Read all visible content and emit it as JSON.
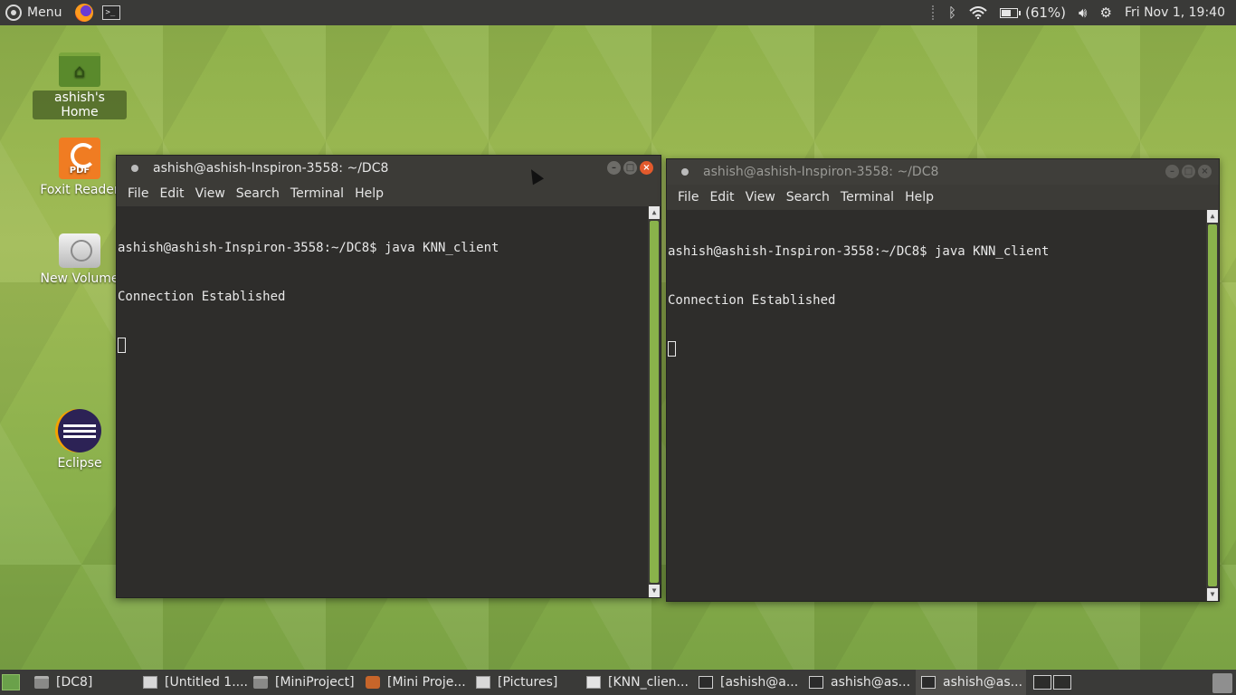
{
  "top_panel": {
    "menu_label": "Menu",
    "battery_text": "(61%)",
    "clock": "Fri Nov 1, 19:40",
    "launchers": [
      "firefox-icon",
      "terminal-icon"
    ]
  },
  "desktop": {
    "icons": [
      {
        "label": "ashish's Home",
        "icon": "home-folder-icon"
      },
      {
        "label": "Foxit Reader",
        "icon": "foxit-reader-icon"
      },
      {
        "label": "New Volume",
        "icon": "drive-icon"
      },
      {
        "label": "Eclipse",
        "icon": "eclipse-icon"
      }
    ]
  },
  "terminal_left": {
    "title": "ashish@ashish-Inspiron-3558: ~/DC8",
    "menu": [
      "File",
      "Edit",
      "View",
      "Search",
      "Terminal",
      "Help"
    ],
    "lines": [
      "ashish@ashish-Inspiron-3558:~/DC8$ java KNN_client",
      "Connection Established"
    ]
  },
  "terminal_right": {
    "title": "ashish@ashish-Inspiron-3558: ~/DC8",
    "menu": [
      "File",
      "Edit",
      "View",
      "Search",
      "Terminal",
      "Help"
    ],
    "lines": [
      "ashish@ashish-Inspiron-3558:~/DC8$ java KNN_client",
      "Connection Established"
    ]
  },
  "taskbar": {
    "tasks": [
      {
        "label": "[DC8]",
        "icon": "folder-icon"
      },
      {
        "label": "[Untitled 1....",
        "icon": "document-icon"
      },
      {
        "label": "[MiniProject]",
        "icon": "folder-icon"
      },
      {
        "label": "[Mini Proje...",
        "icon": "presentation-icon"
      },
      {
        "label": "[Pictures]",
        "icon": "image-viewer-icon"
      },
      {
        "label": "[KNN_clien...",
        "icon": "text-editor-icon"
      },
      {
        "label": "[ashish@a...",
        "icon": "terminal-icon"
      },
      {
        "label": "ashish@as...",
        "icon": "terminal-icon"
      },
      {
        "label": "ashish@as...",
        "icon": "terminal-icon"
      }
    ]
  },
  "colors": {
    "panel": "#3a3a38",
    "terminal_bg": "#2e2d2b",
    "accent_green": "#8ab34b",
    "close_button": "#e25a2c"
  }
}
